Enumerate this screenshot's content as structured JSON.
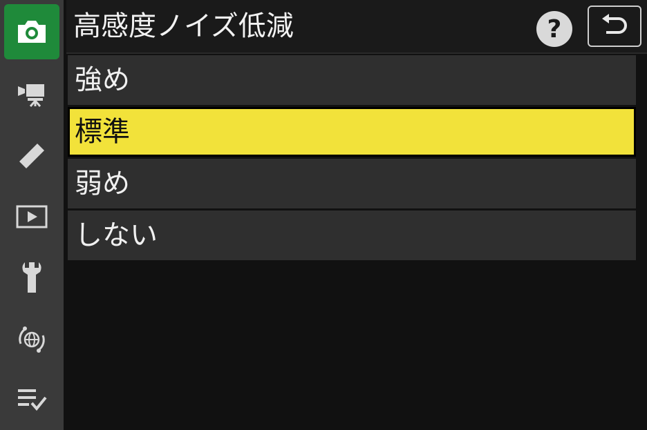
{
  "header": {
    "title": "高感度ノイズ低減",
    "help_label": "?"
  },
  "sidebar": {
    "items": [
      {
        "icon": "camera-icon",
        "active": true
      },
      {
        "icon": "movie-camera-icon",
        "active": false
      },
      {
        "icon": "pencil-icon",
        "active": false
      },
      {
        "icon": "playback-icon",
        "active": false
      },
      {
        "icon": "wrench-icon",
        "active": false
      },
      {
        "icon": "network-icon",
        "active": false
      },
      {
        "icon": "my-menu-icon",
        "active": false
      }
    ]
  },
  "options": [
    {
      "label": "強め",
      "selected": false
    },
    {
      "label": "標準",
      "selected": true
    },
    {
      "label": "弱め",
      "selected": false
    },
    {
      "label": "しない",
      "selected": false
    }
  ],
  "colors": {
    "active_tab": "#1f8a3a",
    "selection": "#f2e23a",
    "background": "#111111"
  }
}
